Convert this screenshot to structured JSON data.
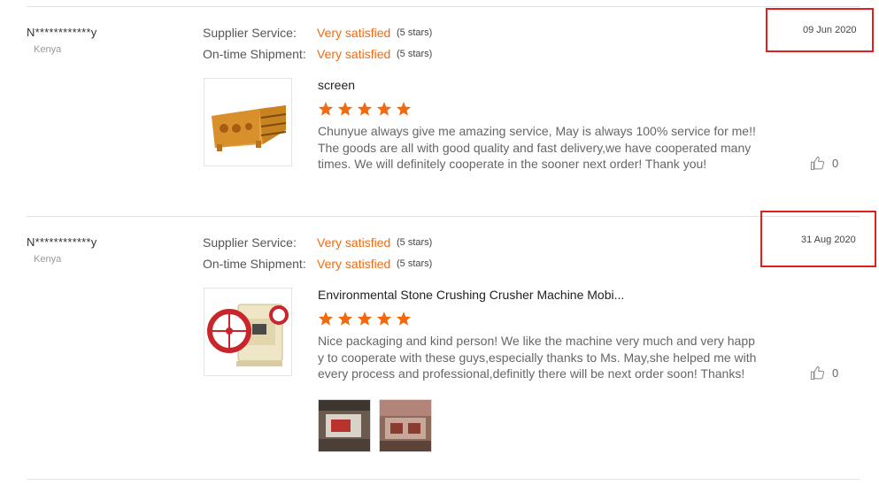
{
  "reviews": [
    {
      "user": "N************y",
      "country": "Kenya",
      "ratings": [
        {
          "label": "Supplier Service:",
          "value": "Very satisfied",
          "stars": "(5 stars)"
        },
        {
          "label": "On-time Shipment:",
          "value": "Very satisfied",
          "stars": "(5 stars)"
        }
      ],
      "date": "09 Jun 2020",
      "product_title": "screen",
      "star_rating": 5,
      "text": "Chunyue always give me amazing service, May is always 100% service for me!! The goods are all with good quality and fast delivery,we have cooperated many times. We will definitely cooperate in the sooner next order! Thank you!",
      "likes": "0"
    },
    {
      "user": "N************y",
      "country": "Kenya",
      "ratings": [
        {
          "label": "Supplier Service:",
          "value": "Very satisfied",
          "stars": "(5 stars)"
        },
        {
          "label": "On-time Shipment:",
          "value": "Very satisfied",
          "stars": "(5 stars)"
        }
      ],
      "date": "31 Aug 2020",
      "product_title": "Environmental Stone Crushing Crusher Machine Mobi...",
      "star_rating": 5,
      "text": "Nice packaging and kind person! We like the machine very much and very happy to cooperate with these guys,especially thanks to Ms. May,she helped me with every  process and professional,definitly there will be next order soon! Thanks!",
      "likes": "0"
    }
  ],
  "colors": {
    "accent": "#f26a10",
    "highlight_box": "#e02020",
    "star": "#f26a10"
  },
  "icons": {
    "like": "thumbs-up-icon",
    "star": "star-icon"
  }
}
